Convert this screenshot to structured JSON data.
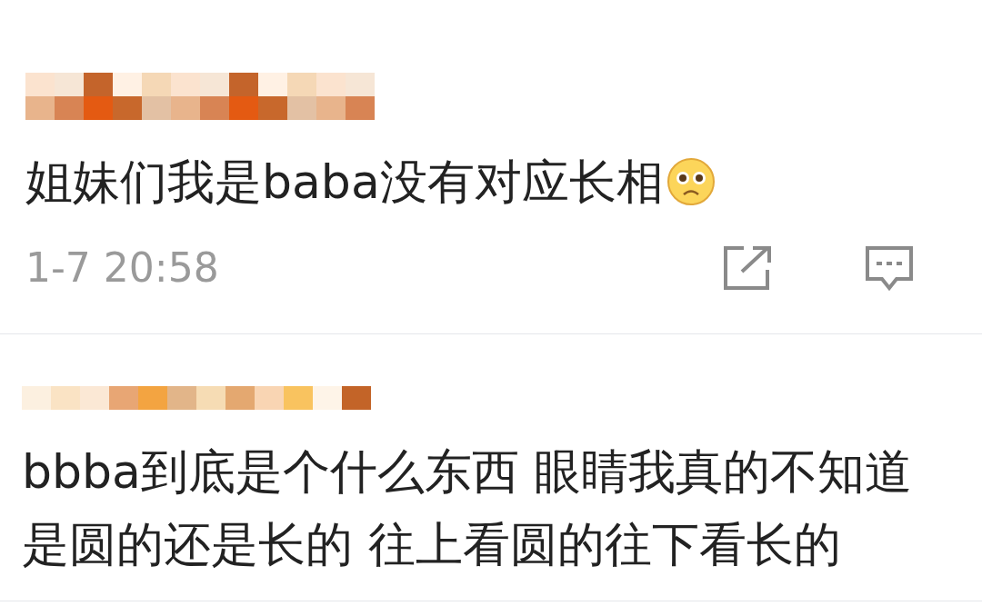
{
  "comments": [
    {
      "lines": [
        "姐妹们我是baba没有对应长相"
      ],
      "emoji": true,
      "time": "1-7 20:58"
    },
    {
      "lines": [
        "bbba到底是个什么东西 眼睛我真的不知道",
        "是圆的还是长的 往上看圆的往下看长的"
      ],
      "emoji": false
    }
  ]
}
